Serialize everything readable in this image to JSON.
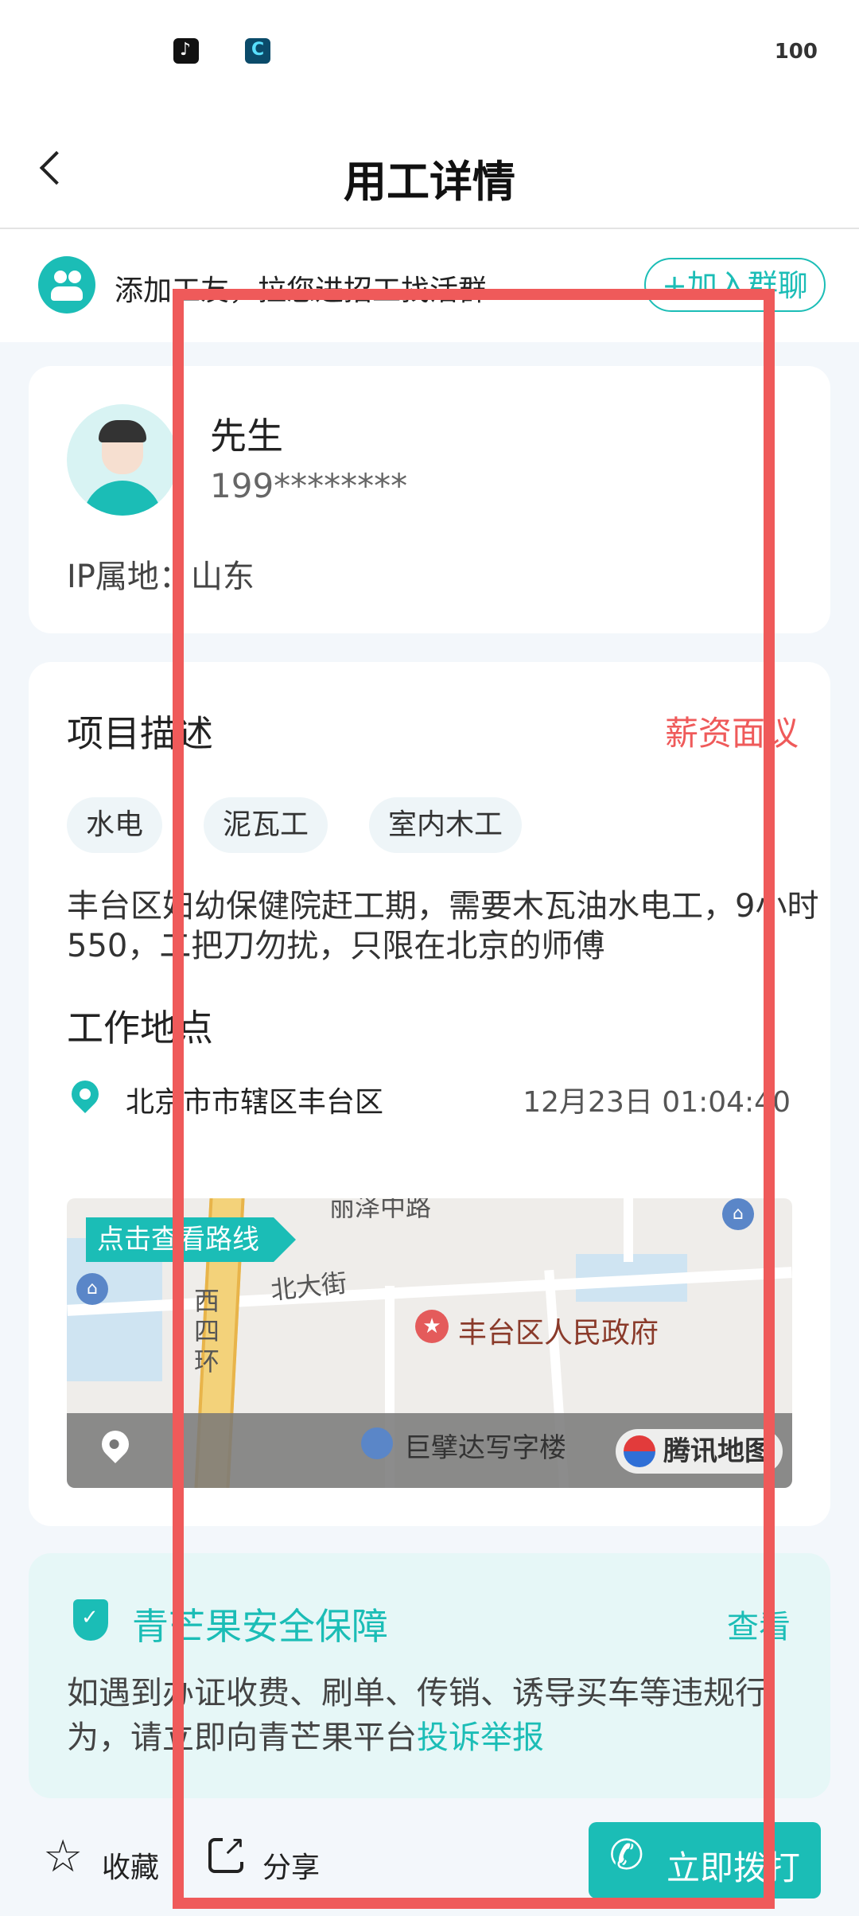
{
  "status_bar": {
    "battery": "100"
  },
  "header": {
    "title": "用工详情"
  },
  "invite": {
    "text": "添加工友，拉您进招工找活群",
    "button": "+加入群聊"
  },
  "profile": {
    "name": "先生",
    "phone": "199********",
    "ip_location": "IP属地：山东"
  },
  "job": {
    "section_title": "项目描述",
    "salary": "薪资面议",
    "tags": [
      "水电",
      "泥瓦工",
      "室内木工"
    ],
    "description": "丰台区妇幼保健院赶工期，需要木瓦油水电工，9小时550，二把刀勿扰，只限在北京的师傅",
    "location_title": "工作地点",
    "location": "北京市市辖区丰台区",
    "time": "12月23日 01:04:40"
  },
  "map": {
    "route_button": "点击查看路线",
    "road_label_1": "北大街",
    "ring_road_label": "西四环",
    "poi": "丰台区人民政府",
    "top_label": "丽泽中路",
    "building": "巨擘达写字楼",
    "provider": "腾讯地图"
  },
  "safety": {
    "title": "青芒果安全保障",
    "view": "查看",
    "text": "如遇到办证收费、刷单、传销、诱导买车等违规行为，请立即向青芒果平台",
    "link": "投诉举报"
  },
  "bottom_bar": {
    "favorite": "收藏",
    "share": "分享",
    "call": "立即拨打"
  },
  "colors": {
    "accent": "#1bbdb6",
    "salary": "#ef5a5a",
    "highlight_box": "#ef5a5a"
  }
}
